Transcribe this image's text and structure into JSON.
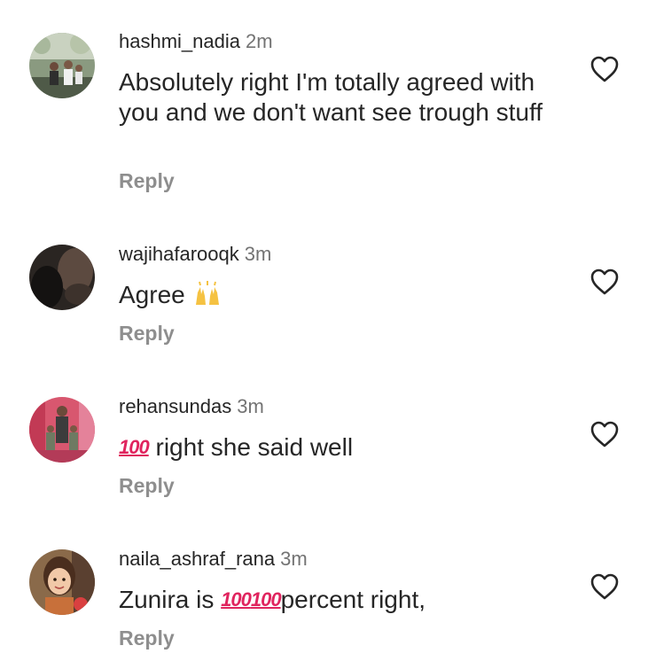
{
  "comments": [
    {
      "username": "hashmi_nadia",
      "time": "2m",
      "text": "Absolutely right I'm totally agreed with you and we don't want see trough stuff",
      "reply": "Reply",
      "avatar": "family-photo-avatar"
    },
    {
      "username": "wajihafarooqk",
      "time": "3m",
      "text_before": "Agree ",
      "emoji": "raising-hands-emoji",
      "reply": "Reply",
      "avatar": "dark-profile-avatar"
    },
    {
      "username": "rehansundas",
      "time": "3m",
      "emoji": "hundred-points-emoji",
      "emoji_text": "100",
      "text_after": " right she said well",
      "reply": "Reply",
      "avatar": "family-pink-background-avatar"
    },
    {
      "username": "naila_ashraf_rana",
      "time": "3m",
      "text_before": "Zunira is ",
      "emoji": "hundred-points-emoji",
      "emoji_text": "100",
      "text_after": "percent right,",
      "reply": "Reply",
      "avatar": "child-photo-avatar"
    }
  ],
  "icons": {
    "like": "heart-outline-icon"
  },
  "colors": {
    "text": "#262626",
    "secondary": "#737373",
    "reply": "#8e8e8e",
    "hundred": "#e0245e"
  }
}
